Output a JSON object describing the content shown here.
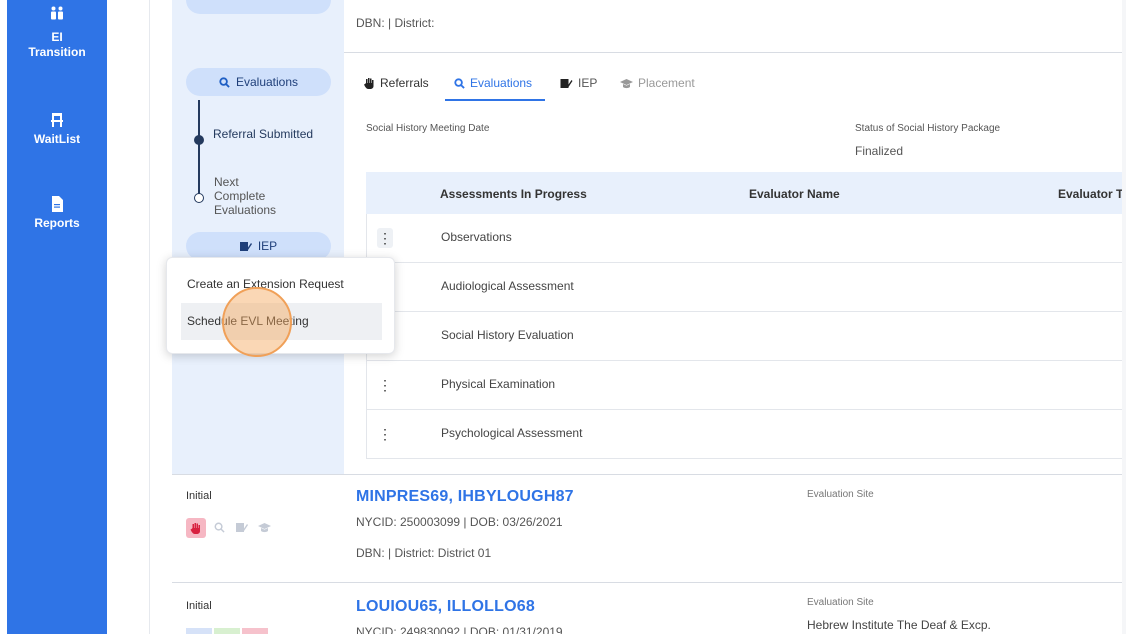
{
  "app_nav": {
    "items": [
      {
        "label": "EI\nTransition",
        "icon": "people-icon"
      },
      {
        "label": "WaitList",
        "icon": "chair-icon"
      },
      {
        "label": "Reports",
        "icon": "document-icon"
      }
    ]
  },
  "stage_panel": {
    "evaluations_pill": "Evaluations",
    "iep_pill": "IEP",
    "timeline": [
      {
        "text": "Referral Submitted",
        "state": "done"
      },
      {
        "next_label": "Next",
        "text": "Complete Evaluations",
        "state": "next"
      }
    ]
  },
  "header": {
    "dbn_line": "DBN: | District:"
  },
  "tabs": [
    {
      "label": "Referrals",
      "icon": "hand-icon",
      "active": false
    },
    {
      "label": "Evaluations",
      "icon": "search-icon",
      "active": true
    },
    {
      "label": "IEP",
      "icon": "iep-icon",
      "active": false
    },
    {
      "label": "Placement",
      "icon": "graduation-cap-icon",
      "active": false
    }
  ],
  "summary": {
    "shm_label": "Social History Meeting Date",
    "status_label": "Status of Social History Package",
    "status_value": "Finalized"
  },
  "table": {
    "columns": [
      "Assessments In Progress",
      "Evaluator Name",
      "Evaluator Ty"
    ],
    "rows": [
      {
        "assessment": "Observations"
      },
      {
        "assessment": "Audiological Assessment"
      },
      {
        "assessment": "Social History Evaluation"
      },
      {
        "assessment": "Physical Examination"
      },
      {
        "assessment": "Psychological Assessment"
      }
    ]
  },
  "context_menu": {
    "items": [
      "Create an Extension Request",
      "Schedule EVL Meeting"
    ]
  },
  "records": [
    {
      "type": "Initial",
      "name": "MINPRES69, IHBYLOUGH87",
      "ids": "NYCID: 250003099 | DOB: 03/26/2021",
      "dbn": "DBN: | District: District 01",
      "site_label": "Evaluation Site",
      "site_value": ""
    },
    {
      "type": "Initial",
      "name": "LOUIOU65, ILLOLLO68",
      "ids": "NYCID: 249830092 | DOB: 01/31/2019",
      "site_label": "Evaluation Site",
      "site_value": "Hebrew Institute The Deaf & Excp."
    }
  ],
  "colors": {
    "nav_blue": "#2f74e6",
    "panel_bg": "#e8f0fc",
    "pill_bg": "#cfe0fb",
    "highlight": "#f0a058"
  }
}
